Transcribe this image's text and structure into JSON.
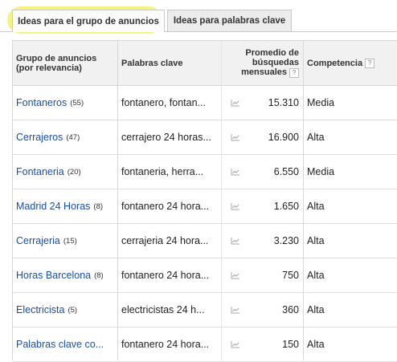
{
  "tabs": [
    {
      "label": "Ideas para el grupo de anuncios"
    },
    {
      "label": "Ideas para palabras clave"
    }
  ],
  "table": {
    "headers": {
      "group": [
        "Grupo de anuncios",
        "(por relevancia)"
      ],
      "keywords": "Palabras clave",
      "avg": [
        "Promedio de",
        "búsquedas",
        "mensuales"
      ],
      "competition": "Competencia",
      "help": "?"
    },
    "rows": [
      {
        "group": "Fontaneros",
        "count": "(55)",
        "keywords": "fontanero, fontan...",
        "avg": "15.310",
        "competition": "Media"
      },
      {
        "group": "Cerrajeros",
        "count": "(47)",
        "keywords": "cerrajero 24 horas...",
        "avg": "16.900",
        "competition": "Alta"
      },
      {
        "group": "Fontaneria",
        "count": "(20)",
        "keywords": "fontaneria, herra...",
        "avg": "6.550",
        "competition": "Media"
      },
      {
        "group": "Madrid 24 Horas",
        "count": "(8)",
        "keywords": "fontanero 24 hora...",
        "avg": "1.650",
        "competition": "Alta"
      },
      {
        "group": "Cerrajeria",
        "count": "(15)",
        "keywords": "cerrajeria 24 hora...",
        "avg": "3.230",
        "competition": "Alta"
      },
      {
        "group": "Horas Barcelona",
        "count": "(8)",
        "keywords": "fontanero 24 hora...",
        "avg": "750",
        "competition": "Alta"
      },
      {
        "group": "Electricista",
        "count": "(5)",
        "keywords": "electricistas 24 h...",
        "avg": "360",
        "competition": "Alta"
      },
      {
        "group": "Palabras clave co...",
        "count": "",
        "keywords": "fontanero 24 hora...",
        "avg": "150",
        "competition": "Alta"
      }
    ]
  }
}
